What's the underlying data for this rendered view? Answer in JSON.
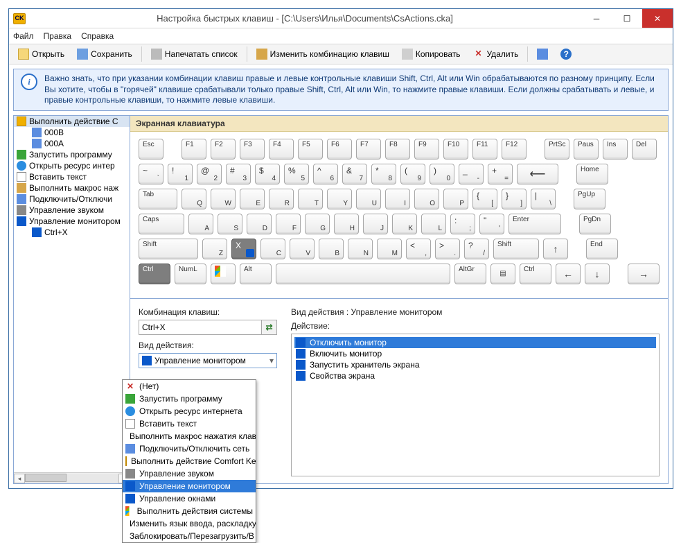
{
  "title": "Настройка быстрых клавиш - [C:\\Users\\Илья\\Documents\\CsActions.cka]",
  "menu": {
    "file": "Файл",
    "edit": "Правка",
    "help": "Справка"
  },
  "toolbar": {
    "open": "Открыть",
    "save": "Сохранить",
    "print": "Напечатать список",
    "change": "Изменить комбинацию клавиш",
    "copy": "Копировать",
    "delete": "Удалить"
  },
  "info": "Важно знать, что при указании комбинации клавиш правые и левые контрольные клавиши Shift, Ctrl, Alt или Win обрабатываются по разному принципу. Если Вы хотите, чтобы в \"горячей\" клавише срабатывали только правые Shift, Ctrl, Alt или Win, то нажмите правые клавиши. Если должны срабатывать и левые, и правые контрольные клавиши, то нажмите левые клавиши.",
  "tree": {
    "i0": "Выполнить действие C",
    "i1": "000B",
    "i2": "000A",
    "i3": "Запустить программу",
    "i4": "Открыть ресурс интер",
    "i5": "Вставить текст",
    "i6": "Выполнить макрос наж",
    "i7": "Подключить/Отключи",
    "i8": "Управление звуком",
    "i9": "Управление монитором",
    "i10": "Ctrl+X"
  },
  "kb": {
    "header": "Экранная клавиатура",
    "esc": "Esc",
    "f1": "F1",
    "f2": "F2",
    "f3": "F3",
    "f4": "F4",
    "f5": "F5",
    "f6": "F6",
    "f7": "F7",
    "f8": "F8",
    "f9": "F9",
    "f10": "F10",
    "f11": "F11",
    "f12": "F12",
    "prtsc": "PrtSc",
    "pause": "Paus",
    "ins": "Ins",
    "del": "Del",
    "grave": "`",
    "tilde": "~",
    "d1": "1",
    "s1": "!",
    "d2": "2",
    "s2": "@",
    "d3": "3",
    "s3": "#",
    "d4": "4",
    "s4": "$",
    "d5": "5",
    "s5": "%",
    "d6": "6",
    "s6": "^",
    "d7": "7",
    "s7": "&",
    "d8": "8",
    "s8": "*",
    "d9": "9",
    "s9": "(",
    "d0": "0",
    "s0": ")",
    "minus": "-",
    "under": "_",
    "eq": "=",
    "plus": "+",
    "home": "Home",
    "tab": "Tab",
    "q": "Q",
    "w": "W",
    "e": "E",
    "r": "R",
    "t": "T",
    "y": "Y",
    "u": "U",
    "i": "I",
    "o": "O",
    "p": "P",
    "lb": "[",
    "lbb": "{",
    "rb": "]",
    "rbb": "}",
    "bslash": "\\",
    "pipe": "|",
    "pgup": "PgUp",
    "caps": "Caps",
    "a": "A",
    "s": "S",
    "d": "D",
    "f": "F",
    "g": "G",
    "h": "H",
    "j": "J",
    "k": "K",
    "l": "L",
    "semi": ";",
    "colon": ":",
    "apos": "'",
    "quote": "\"",
    "enter": "Enter",
    "pgdn": "PgDn",
    "lshift": "Shift",
    "z": "Z",
    "x": "X",
    "c": "C",
    "v": "V",
    "b": "B",
    "n": "N",
    "m": "M",
    "comma": ",",
    "lt": "<",
    "period": ".",
    "gt": ">",
    "slash": "/",
    "qm": "?",
    "rshift": "Shift",
    "up": "↑",
    "end": "End",
    "lctrl": "Ctrl",
    "numl": "NumL",
    "lalt": "Alt",
    "altgr": "AltGr",
    "menu": "▤",
    "rctrl": "Ctrl",
    "left": "←",
    "down": "↓",
    "right": "→"
  },
  "form": {
    "combo_label": "Комбинация клавиш:",
    "combo_value": "Ctrl+X",
    "type_label": "Вид действия:",
    "type_value": "Управление монитором",
    "action_header": "Вид действия : Управление монитором",
    "action_label": "Действие:"
  },
  "actions": {
    "a0": "Отключить монитор",
    "a1": "Включить монитор",
    "a2": "Запустить хранитель экрана",
    "a3": "Свойства экрана"
  },
  "dd": {
    "d0": "(Нет)",
    "d1": "Запустить программу",
    "d2": "Открыть ресурс интернета",
    "d3": "Вставить текст",
    "d4": "Выполнить макрос нажатия клав",
    "d5": "Подключить/Отключить сеть",
    "d6": "Выполнить действие Comfort Key",
    "d7": "Управление звуком",
    "d8": "Управление монитором",
    "d9": "Управление окнами",
    "d10": "Выполнить действия системы",
    "d11": "Изменить язык ввода, раскладку",
    "d12": "Заблокировать/Перезагрузить/В"
  }
}
